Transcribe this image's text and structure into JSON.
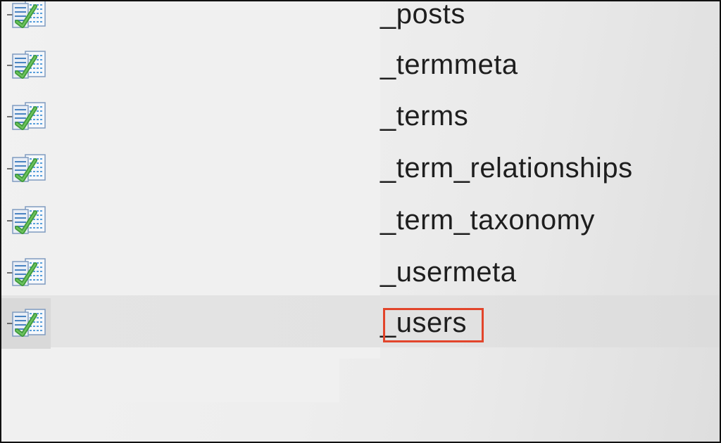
{
  "tables": [
    {
      "name": "_posts",
      "icon": "table-icon"
    },
    {
      "name": "_termmeta",
      "icon": "table-icon"
    },
    {
      "name": "_terms",
      "icon": "table-icon"
    },
    {
      "name": "_term_relationships",
      "icon": "table-icon"
    },
    {
      "name": "_term_taxonomy",
      "icon": "table-icon"
    },
    {
      "name": "_usermeta",
      "icon": "table-icon"
    },
    {
      "name": "_users",
      "icon": "table-icon",
      "selected": true
    }
  ],
  "colors": {
    "highlight_border": "#e2452b",
    "selected_row": "#e2e2e2",
    "text": "#1e1e1e"
  }
}
